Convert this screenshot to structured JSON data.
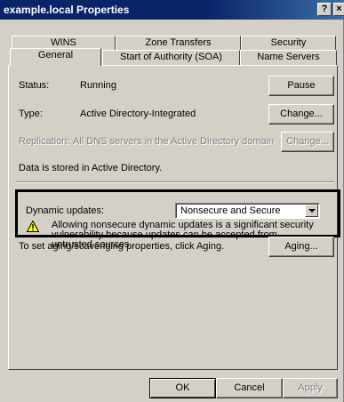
{
  "window": {
    "title": "example.local Properties",
    "help_glyph": "?",
    "close_glyph": "×"
  },
  "tabs": {
    "row1": [
      "WINS",
      "Zone Transfers",
      "Security"
    ],
    "row2": [
      "General",
      "Start of Authority (SOA)",
      "Name Servers"
    ],
    "selected": "General"
  },
  "general": {
    "status_label": "Status:",
    "status_value": "Running",
    "pause_button": "Pause",
    "type_label": "Type:",
    "type_value": "Active Directory-Integrated",
    "change_type_button": "Change...",
    "replication_label": "Replication:",
    "replication_value": "All DNS servers in the Active Directory domain",
    "change_replication_button": "Change...",
    "storage_text": "Data is stored in Active Directory.",
    "dynamic_updates_label": "Dynamic updates:",
    "dynamic_updates_value": "Nonsecure and Secure",
    "warning_text": "Allowing nonsecure dynamic updates is a significant security vulnerability because updates can be accepted from untrusted sources.",
    "aging_text": "To set aging/scavenging properties, click Aging.",
    "aging_button": "Aging..."
  },
  "footer": {
    "ok_button": "OK",
    "cancel_button": "Cancel",
    "apply_button": "Apply"
  },
  "icons": {
    "warning": "warning-icon",
    "dropdown": "chevron-down-icon"
  },
  "colors": {
    "title_bar": "#0a246a",
    "dialog_face": "#d4d0c8",
    "highlight_border": "#000000"
  }
}
